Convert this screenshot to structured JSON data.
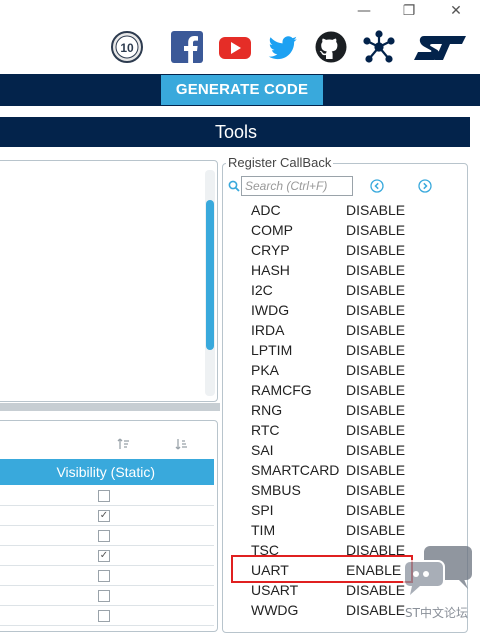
{
  "window": {
    "minimize": "—",
    "restore": "❐",
    "close": "✕"
  },
  "social": {
    "anniversary_badge": "10",
    "icons": [
      "anniversary-badge-icon",
      "facebook-icon",
      "youtube-icon",
      "twitter-icon",
      "github-icon",
      "network-icon",
      "st-logo-icon"
    ]
  },
  "toolbar": {
    "generate_label": "GENERATE CODE"
  },
  "tools_title": "Tools",
  "left_lower": {
    "column_header": "Visibility (Static)",
    "checkboxes": [
      false,
      true,
      false,
      true,
      false,
      false,
      false
    ]
  },
  "register_callback": {
    "title": "Register CallBack",
    "search_placeholder": "Search (Ctrl+F)",
    "rows": [
      {
        "name": "ADC",
        "value": "DISABLE"
      },
      {
        "name": "COMP",
        "value": "DISABLE"
      },
      {
        "name": "CRYP",
        "value": "DISABLE"
      },
      {
        "name": "HASH",
        "value": "DISABLE"
      },
      {
        "name": "I2C",
        "value": "DISABLE"
      },
      {
        "name": "IWDG",
        "value": "DISABLE"
      },
      {
        "name": "IRDA",
        "value": "DISABLE"
      },
      {
        "name": "LPTIM",
        "value": "DISABLE"
      },
      {
        "name": "PKA",
        "value": "DISABLE"
      },
      {
        "name": "RAMCFG",
        "value": "DISABLE"
      },
      {
        "name": "RNG",
        "value": "DISABLE"
      },
      {
        "name": "RTC",
        "value": "DISABLE"
      },
      {
        "name": "SAI",
        "value": "DISABLE"
      },
      {
        "name": "SMARTCARD",
        "value": "DISABLE"
      },
      {
        "name": "SMBUS",
        "value": "DISABLE"
      },
      {
        "name": "SPI",
        "value": "DISABLE"
      },
      {
        "name": "TIM",
        "value": "DISABLE"
      },
      {
        "name": "TSC",
        "value": "DISABLE"
      },
      {
        "name": "UART",
        "value": "ENABLE"
      },
      {
        "name": "USART",
        "value": "DISABLE"
      },
      {
        "name": "WWDG",
        "value": "DISABLE"
      }
    ],
    "highlighted_row": "UART"
  },
  "watermark": "ST中文论坛",
  "colors": {
    "navy": "#03234b",
    "accent": "#39a9dc",
    "highlight": "#e02020"
  }
}
